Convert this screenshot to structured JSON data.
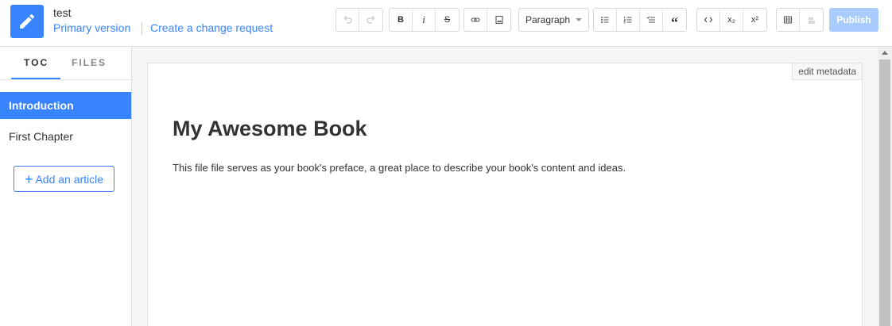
{
  "header": {
    "book_title": "test",
    "version_label": "Primary version",
    "change_request_label": "Create a change request",
    "publish_label": "Publish"
  },
  "toolbar": {
    "bold": "B",
    "italic": "i",
    "strike": "S",
    "paragraph": "Paragraph",
    "quote": "“",
    "subscript": "x₂",
    "superscript": "x²"
  },
  "sidebar": {
    "tabs": [
      {
        "label": "TOC"
      },
      {
        "label": "FILES"
      }
    ],
    "items": [
      {
        "label": "Introduction"
      },
      {
        "label": "First Chapter"
      }
    ],
    "add_article_label": "Add an article"
  },
  "editor": {
    "edit_metadata_label": "edit metadata",
    "title": "My Awesome Book",
    "paragraph": "This file file serves as your book's preface, a great place to describe your book's content and ideas."
  },
  "colors": {
    "accent": "#3884ff",
    "publish_disabled": "#a9ccff"
  },
  "icons": [
    "edit-pencil-icon",
    "undo-icon",
    "redo-icon",
    "link-icon",
    "image-icon",
    "bullet-list-icon",
    "numbered-list-icon",
    "checklist-icon",
    "code-icon",
    "table-icon",
    "math-icon"
  ]
}
